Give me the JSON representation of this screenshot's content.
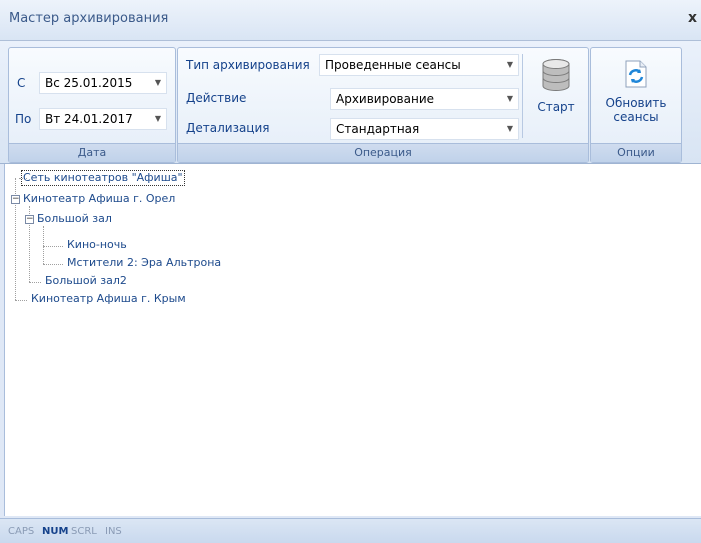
{
  "window": {
    "title": "Мастер архивирования",
    "close_label": "x"
  },
  "date_group": {
    "from_label": "С",
    "from_value": "Вс 25.01.2015",
    "to_label": "По",
    "to_value": "Вт 24.01.2017",
    "caption": "Дата"
  },
  "operation_group": {
    "type_label": "Тип архивирования",
    "type_value": "Проведенные сеансы",
    "action_label": "Действие",
    "action_value": "Архивирование",
    "detail_label": "Детализация",
    "detail_value": "Стандартная",
    "start_label": "Старт",
    "caption": "Операция"
  },
  "options_group": {
    "refresh_line1": "Обновить",
    "refresh_line2": "сеансы",
    "caption": "Опции"
  },
  "tree": {
    "root": "Сеть кинотеатров \"Афиша\"",
    "cinema1": "Кинотеатр Афиша г. Орел",
    "hall1": "Большой зал",
    "session1": "Кино-ночь",
    "session2": "Мстители 2: Эра Альтрона",
    "hall2": "Большой зал2",
    "cinema2": "Кинотеатр Афиша г. Крым"
  },
  "status": {
    "caps": "CAPS",
    "num": "NUM",
    "scrl": "SCRL",
    "ins": "INS"
  },
  "icons": {
    "database": "database-icon",
    "refresh": "refresh-icon",
    "dropdown": "chevron-down-icon"
  }
}
